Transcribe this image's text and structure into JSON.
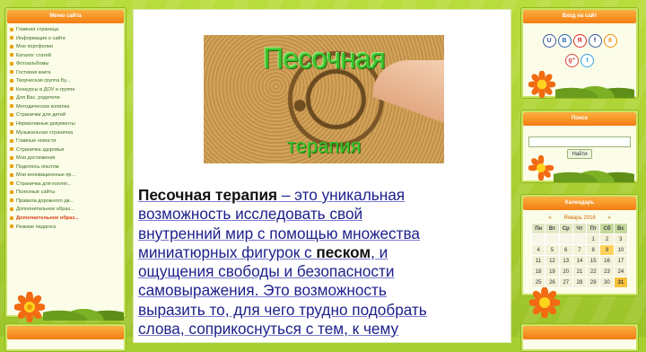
{
  "left_menu": {
    "title": "Меню сайта",
    "items": [
      "Главная страница",
      "Информация о сайте",
      "Мое портфолио",
      "Каталог статей",
      "Фотоальбомы",
      "Гостевая книга",
      "Творческая группа Бу...",
      "Конкурсы в ДОУ и группе",
      "Для Вас, родители",
      "Методическая копилка",
      "Странички для детей",
      "Нормативные документы",
      "Музыкальная страничка",
      "Главные новости",
      "Страничка здоровья",
      "Мои достижения",
      "Поделюсь опытом",
      "Мои инновационные пр...",
      "Страничка для коллег...",
      "Полезные сайты",
      "Правила дорожного дв...",
      "Дополнительное образ...",
      "Дополнительное образ...",
      "Резюме педагога"
    ],
    "active_index": 22
  },
  "hero": {
    "title": "Песочная",
    "subtitle": "терапия"
  },
  "article": {
    "line1_b1": "Песочная",
    "line1_b2": "терапия",
    "line1_rest": " – это уникальная",
    "line2": "возможность исследовать свой",
    "line3": "внутренний мир с помощью множества",
    "line4_a": "миниатюрных фигурок с ",
    "line4_b": "песком",
    "line4_c": ", и",
    "line5": "ощущения свободы и безопасности",
    "line6": "самовыражения. Это возможность",
    "line7": "выразить то, для чего трудно подобрать",
    "line8": "слова, соприкоснуться с тем, к чему"
  },
  "login": {
    "title": "Вход на сайт",
    "socials": [
      {
        "label": "U",
        "color": "#3b5998"
      },
      {
        "label": "B",
        "color": "#2c67a8"
      },
      {
        "label": "Я",
        "color": "#e02b2b"
      },
      {
        "label": "f",
        "color": "#3b5998"
      },
      {
        "label": "8",
        "color": "#f08c00"
      },
      {
        "label": "g⁺",
        "color": "#d34836"
      },
      {
        "label": "t",
        "color": "#2fa3e6"
      }
    ]
  },
  "search": {
    "title": "Поиск",
    "button": "Найти"
  },
  "calendar": {
    "title": "Календарь",
    "prev": "«",
    "month": "Январь 2016",
    "next": "»",
    "weekdays": [
      "Пн",
      "Вт",
      "Ср",
      "Чт",
      "Пт",
      "Сб",
      "Вс"
    ],
    "rows": [
      [
        "",
        "",
        "",
        "",
        "1",
        "2",
        "3"
      ],
      [
        "4",
        "5",
        "6",
        "7",
        "8",
        "9",
        "10"
      ],
      [
        "11",
        "12",
        "13",
        "14",
        "15",
        "16",
        "17"
      ],
      [
        "18",
        "19",
        "20",
        "21",
        "22",
        "23",
        "24"
      ],
      [
        "25",
        "26",
        "27",
        "28",
        "29",
        "30",
        "31"
      ]
    ],
    "note": "Calendar rendered with 9 and 31 highlighted as in screenshot"
  },
  "colors": {
    "page_bg": "#a8cf32",
    "panel_header": "#f47c12",
    "link": "#1c1f8a",
    "menu_text": "#3a6b22"
  }
}
